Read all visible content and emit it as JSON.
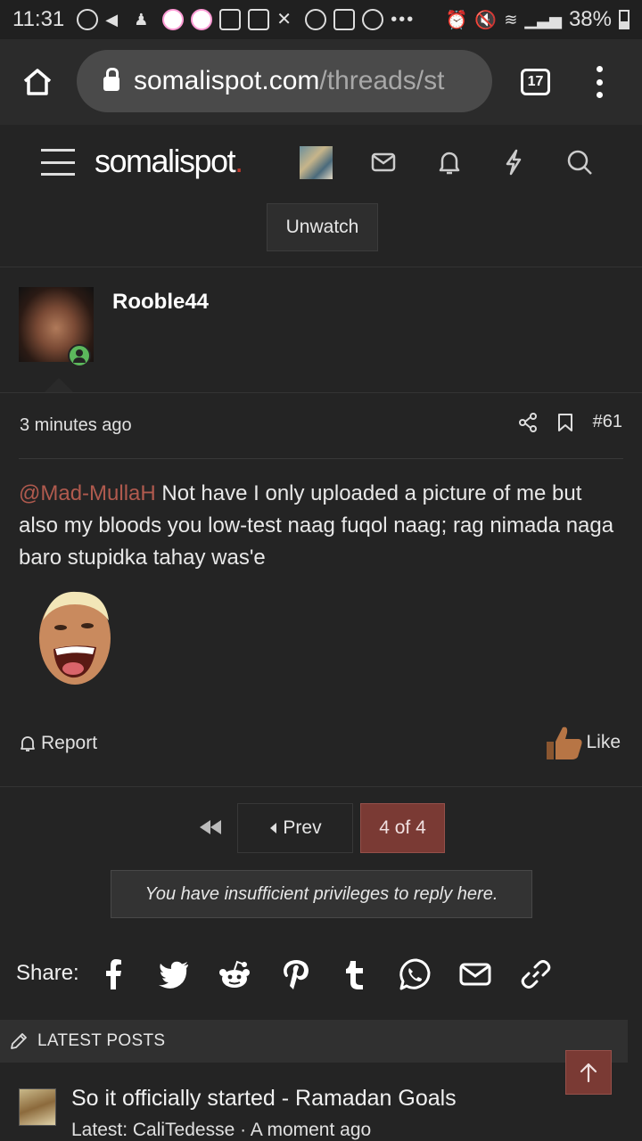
{
  "status_bar": {
    "time": "11:31",
    "battery": "38%"
  },
  "browser": {
    "url_host": "somalispot.com",
    "url_path": "/threads/st",
    "tab_count": "17"
  },
  "site": {
    "logo_text": "somalispot",
    "logo_dot": "."
  },
  "thread": {
    "unwatch_label": "Unwatch"
  },
  "post": {
    "username": "Rooble44",
    "time": "3 minutes ago",
    "number": "#61",
    "mention": "@Mad-MullaH",
    "text": " Not have I only uploaded a picture of me but also my bloods you low-test naag fuqol naag; rag nimada naga baro stupidka tahay was'e",
    "report_label": "Report",
    "like_label": "Like"
  },
  "pagination": {
    "prev_label": "Prev",
    "current_label": "4 of 4"
  },
  "reply_notice": "You have insufficient privileges to reply here.",
  "share": {
    "label": "Share:"
  },
  "latest_posts": {
    "heading": "LATEST POSTS",
    "items": [
      {
        "title": "So it officially started - Ramadan Goals",
        "meta": "Latest: CaliTedesse · A moment ago"
      }
    ]
  },
  "colors": {
    "accent": "#7a3a34",
    "mention": "#b05a4e",
    "background": "#242424",
    "online": "#5cb85c",
    "logo_dot": "#c0392b"
  }
}
